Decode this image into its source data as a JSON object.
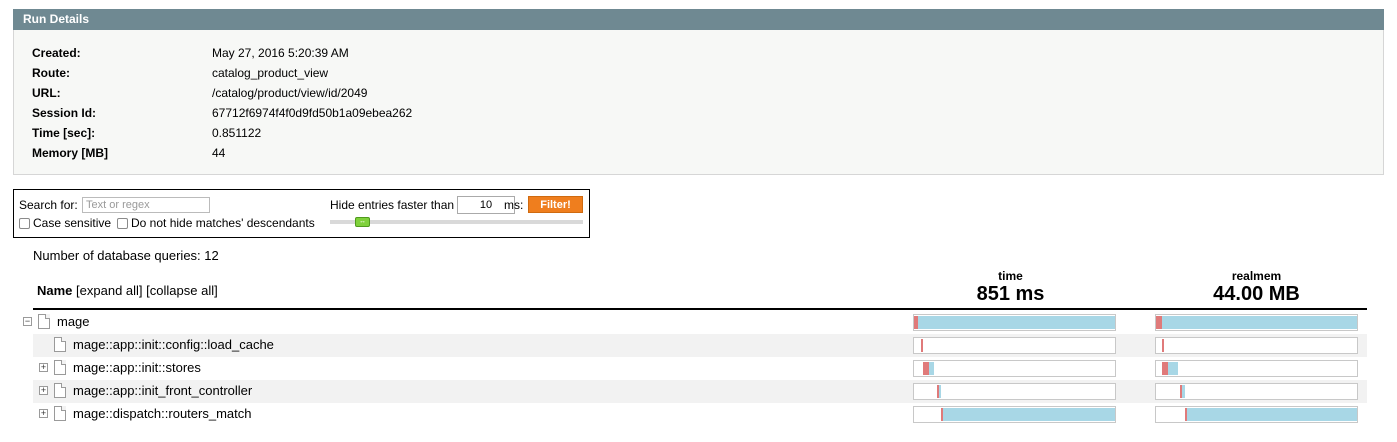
{
  "panel": {
    "title": "Run Details",
    "rows": [
      {
        "label": "Created:",
        "value": "May 27, 2016 5:20:39 AM"
      },
      {
        "label": "Route:",
        "value": "catalog_product_view"
      },
      {
        "label": "URL:",
        "value": "/catalog/product/view/id/2049"
      },
      {
        "label": "Session Id:",
        "value": "67712f6974f4f0d9fd50b1a09ebea262"
      },
      {
        "label": "Time [sec]:",
        "value": "0.851122"
      },
      {
        "label": "Memory [MB]",
        "value": "44"
      }
    ]
  },
  "filter": {
    "search_label": "Search for:",
    "search_placeholder": "Text or regex",
    "search_value": "",
    "case_sensitive_label": "Case sensitive",
    "case_sensitive_checked": false,
    "descendants_label": "Do not hide matches' descendants",
    "descendants_checked": false,
    "hide_label": "Hide entries faster than",
    "hide_value": "10",
    "ms_label": "ms:",
    "button_label": "Filter!",
    "button_color": "#ef7e1e",
    "slider_icon": "slider-handle-icon"
  },
  "summary": {
    "db_queries": "Number of database queries: 12"
  },
  "table": {
    "name_header": "Name",
    "expand_all": "[expand all]",
    "collapse_all": "[collapse all]",
    "columns": [
      {
        "label": "time",
        "total": "851 ms"
      },
      {
        "label": "realmem",
        "total": "44.00 MB"
      }
    ],
    "rows": [
      {
        "name": "mage",
        "expander": "−",
        "level": 0,
        "time": {
          "start": 0.0,
          "own": 0.02,
          "total": 1.0
        },
        "mem": {
          "start": 0.0,
          "own": 0.03,
          "total": 1.0
        }
      },
      {
        "name": "mage::app::init::config::load_cache",
        "expander": "",
        "level": 1,
        "time": {
          "start": 0.035,
          "own": 0.01,
          "total": 0.0
        },
        "mem": {
          "start": 0.03,
          "own": 0.01,
          "total": 0.0
        }
      },
      {
        "name": "mage::app::init::stores",
        "expander": "+",
        "level": 1,
        "time": {
          "start": 0.045,
          "own": 0.03,
          "total": 0.055
        },
        "mem": {
          "start": 0.03,
          "own": 0.03,
          "total": 0.08
        }
      },
      {
        "name": "mage::app::init_front_controller",
        "expander": "+",
        "level": 1,
        "time": {
          "start": 0.115,
          "own": 0.01,
          "total": 0.02
        },
        "mem": {
          "start": 0.12,
          "own": 0.01,
          "total": 0.025
        }
      },
      {
        "name": "mage::dispatch::routers_match",
        "expander": "+",
        "level": 1,
        "time": {
          "start": 0.135,
          "own": 0.01,
          "total": 0.865
        },
        "mem": {
          "start": 0.145,
          "own": 0.01,
          "total": 0.855
        }
      }
    ]
  }
}
